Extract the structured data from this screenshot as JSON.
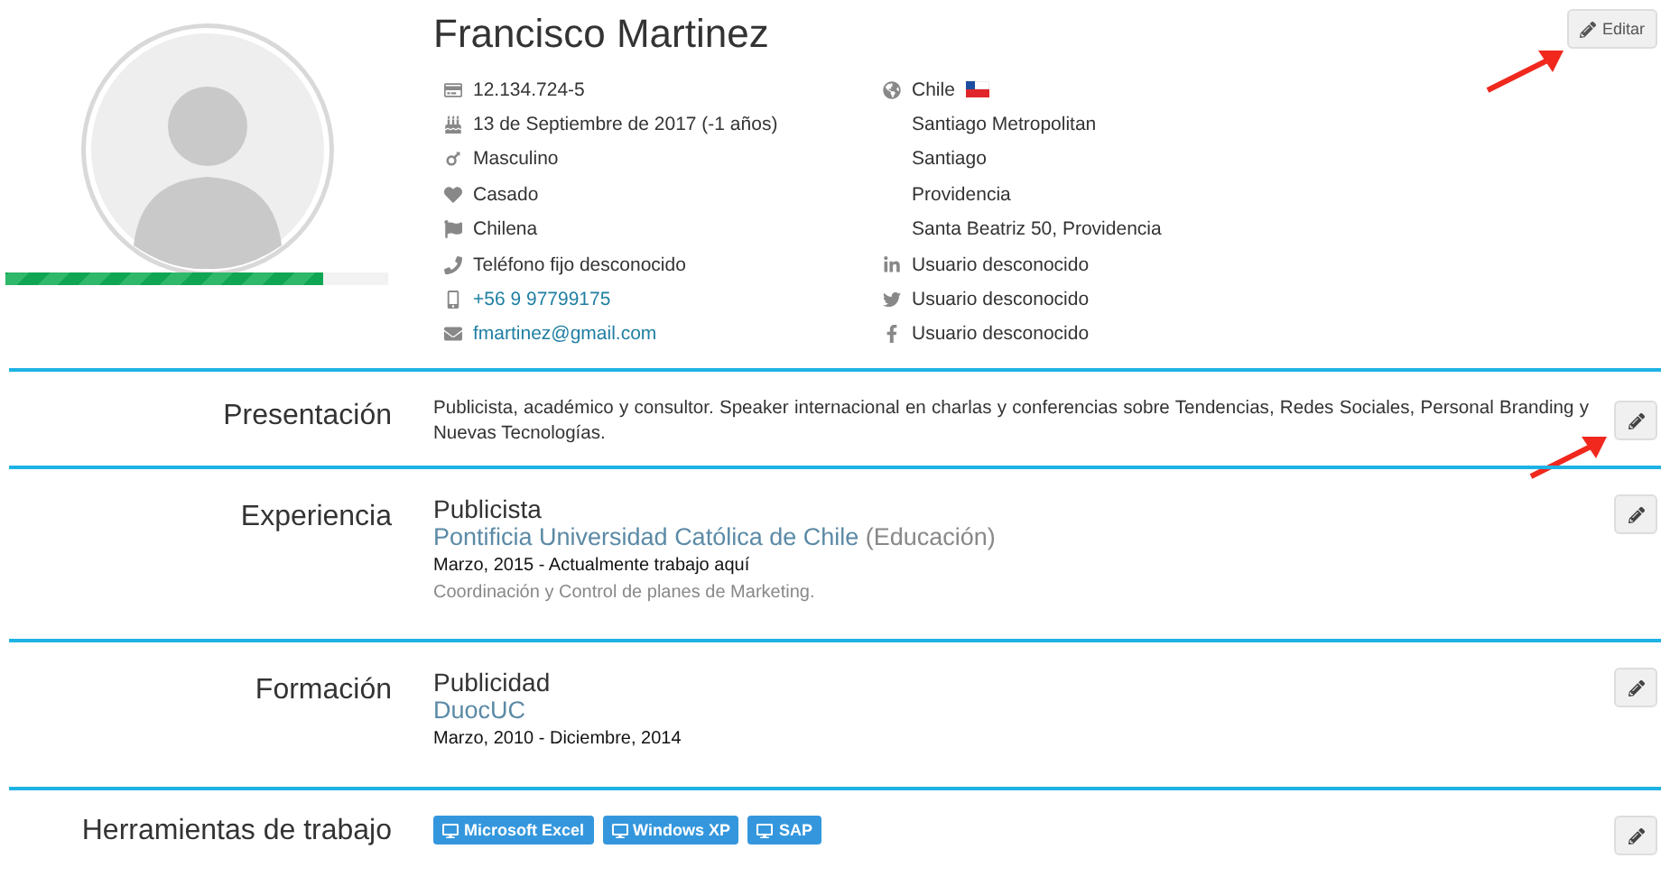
{
  "profile": {
    "name": "Francisco Martinez",
    "completion": {
      "level": 0.83
    },
    "edit_button": "Editar",
    "details_left": [
      {
        "text": "12.134.724-5",
        "link": false
      },
      {
        "text": "13 de Septiembre de 2017 (-1 años)",
        "link": false
      },
      {
        "text": "Masculino",
        "link": false
      },
      {
        "text": "Casado",
        "link": false
      },
      {
        "text": "Chilena",
        "link": false
      },
      {
        "text": "Teléfono fijo desconocido",
        "link": false
      },
      {
        "text": "+56 9 97799175",
        "link": true
      },
      {
        "text": "fmartinez@gmail.com",
        "link": true
      }
    ],
    "details_right": [
      {
        "text": "Chile",
        "flag": true
      },
      {
        "text": "Santiago Metropolitan",
        "flag": false
      },
      {
        "text": "Santiago",
        "flag": false
      },
      {
        "text": "Providencia",
        "flag": false
      },
      {
        "text": "Santa Beatriz 50, Providencia",
        "flag": false
      },
      {
        "text": "Usuario desconocido",
        "flag": false
      },
      {
        "text": "Usuario desconocido",
        "flag": false
      },
      {
        "text": "Usuario desconocido",
        "flag": false
      }
    ]
  },
  "sections": [
    {
      "title": "Presentación",
      "kind": "text",
      "arrow": true,
      "text": "Publicista, académico y consultor. Speaker internacional en charlas y conferencias sobre Tendencias, Redes Sociales, Personal Branding y Nuevas Tecnologías."
    },
    {
      "title": "Experiencia",
      "kind": "entry",
      "arrow": false,
      "heading": "Publicista",
      "institution": "Pontificia Universidad Católica de Chile",
      "category": "(Educación)",
      "dates": "Marzo, 2015 - Actualmente trabajo aquí",
      "description": "Coordinación y Control de planes de Marketing."
    },
    {
      "title": "Formación",
      "kind": "entry",
      "arrow": false,
      "heading": "Publicidad",
      "institution": "DuocUC",
      "dates": "Marzo, 2010 - Diciembre, 2014"
    },
    {
      "title": "Herramientas de trabajo",
      "kind": "tags",
      "arrow": false,
      "tags": [
        "Microsoft Excel",
        "Windows XP",
        "SAP"
      ]
    }
  ]
}
